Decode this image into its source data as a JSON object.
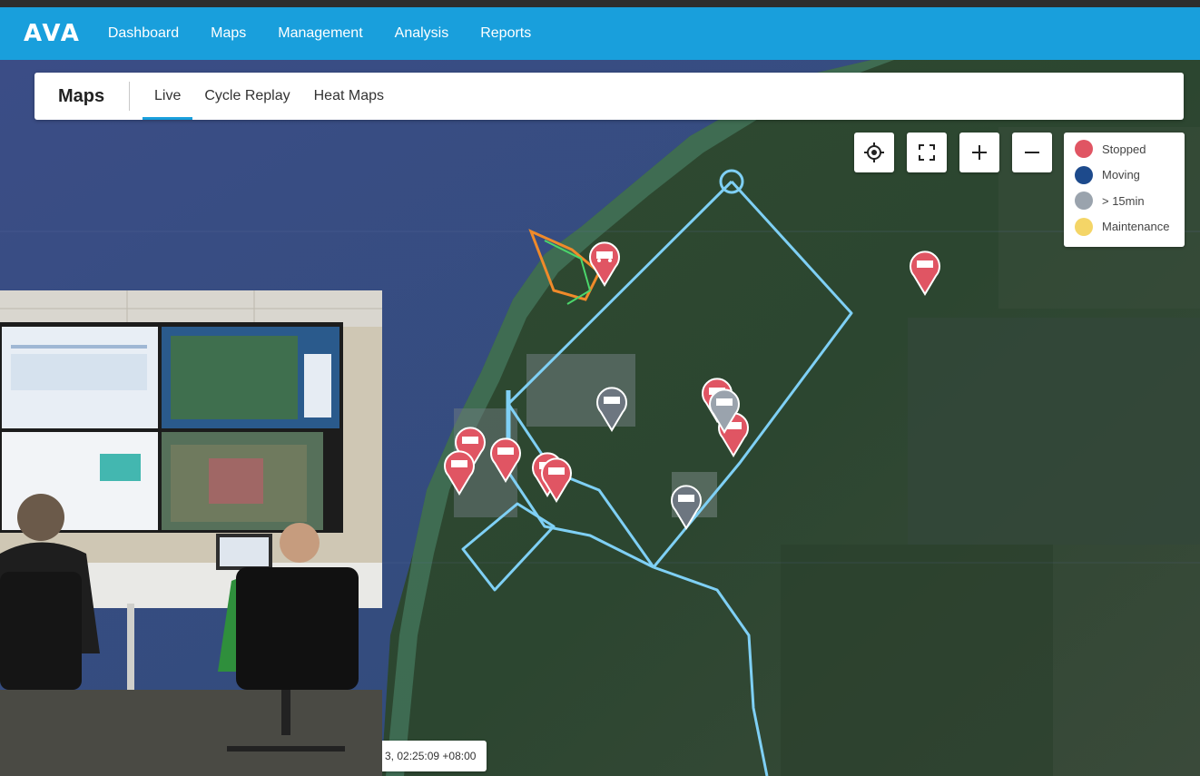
{
  "app": {
    "logo": "AVA"
  },
  "nav": {
    "items": [
      "Dashboard",
      "Maps",
      "Management",
      "Analysis",
      "Reports"
    ]
  },
  "maps_header": {
    "title": "Maps",
    "tabs": [
      "Live",
      "Cycle Replay",
      "Heat Maps"
    ],
    "active_tab": "Live"
  },
  "legend": {
    "items": [
      {
        "label": "Stopped",
        "color": "#e05563"
      },
      {
        "label": "Moving",
        "color": "#1d4a8c"
      },
      {
        "label": "> 15min",
        "color": "#9aa3ad"
      },
      {
        "label": "Maintenance",
        "color": "#f4d567"
      }
    ]
  },
  "map": {
    "timestamp": "3, 02:25:09 +08:00",
    "route_color": "#7fd0f5"
  },
  "colors": {
    "nav_bg": "#199fdc",
    "stopped": "#e05563",
    "long_idle": "#6d7680"
  },
  "icons": {
    "locate": "crosshair-icon",
    "fullscreen": "fullscreen-icon",
    "zoom_in": "plus-icon",
    "zoom_out": "minus-icon"
  }
}
